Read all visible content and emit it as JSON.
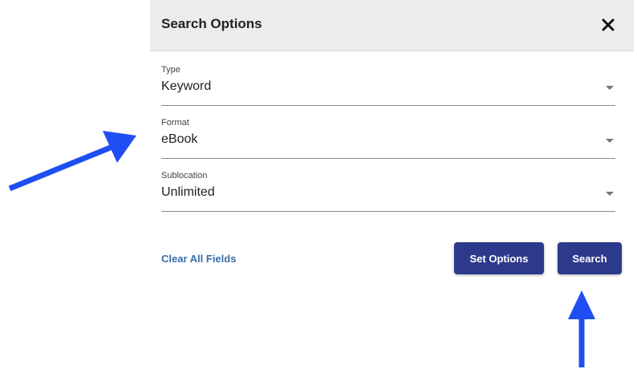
{
  "panel": {
    "title": "Search Options",
    "close_icon": "close-icon"
  },
  "fields": [
    {
      "label": "Type",
      "value": "Keyword"
    },
    {
      "label": "Format",
      "value": "eBook"
    },
    {
      "label": "Sublocation",
      "value": "Unlimited"
    }
  ],
  "actions": {
    "clear_label": "Clear All Fields",
    "set_options_label": "Set Options",
    "search_label": "Search"
  },
  "colors": {
    "button": "#2d3a8c",
    "link": "#3a6ea8",
    "header_bg": "#ececec",
    "annotation_arrow": "#1f4ff2"
  }
}
